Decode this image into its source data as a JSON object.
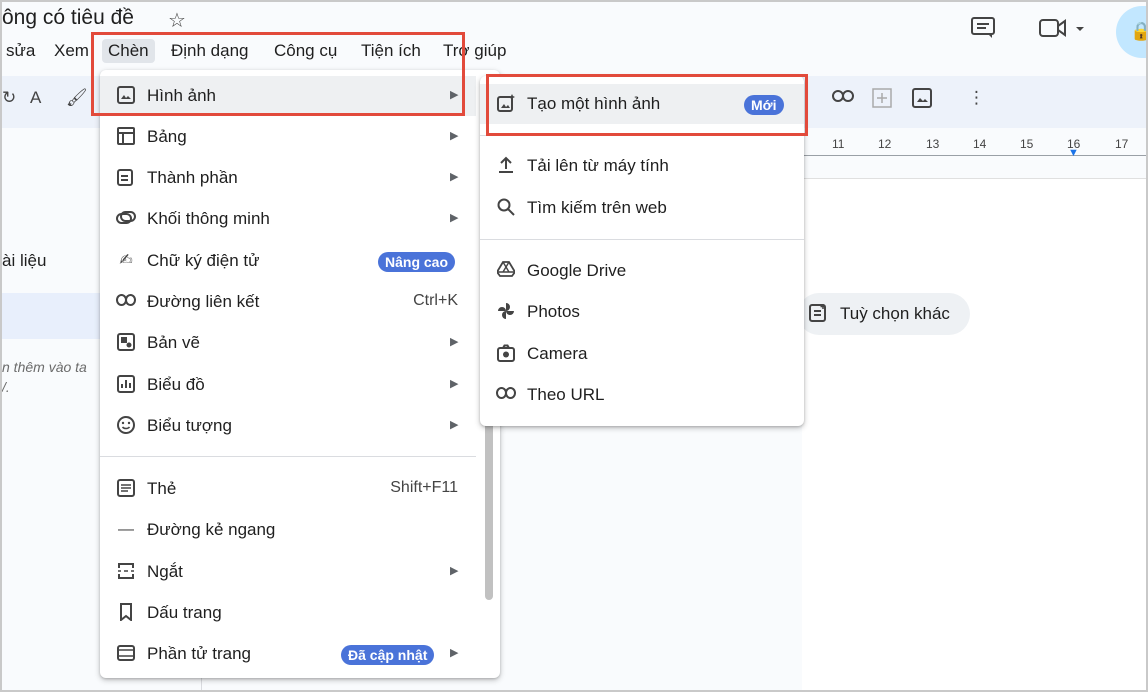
{
  "document": {
    "title": "ông có tiêu đề"
  },
  "menubar": {
    "items": [
      "sửa",
      "Xem",
      "Chèn",
      "Định dạng",
      "Công cụ",
      "Tiện ích",
      "Trợ giúp"
    ]
  },
  "sidebar": {
    "label": "ài liệu",
    "hint_line1": "n thêm vào ta",
    "hint_line2": "/."
  },
  "ruler": {
    "ticks": [
      "11",
      "12",
      "13",
      "14",
      "15",
      "16",
      "17"
    ]
  },
  "more_options": {
    "label": "Tuỳ chọn khác"
  },
  "insert_menu": {
    "items": [
      {
        "label": "Hình ảnh",
        "icon": "image-icon"
      },
      {
        "label": "Bảng",
        "icon": "table-icon"
      },
      {
        "label": "Thành phần",
        "icon": "building-blocks-icon"
      },
      {
        "label": "Khối thông minh",
        "icon": "smart-chips-icon"
      },
      {
        "label": "Chữ ký điện tử",
        "icon": "esignature-icon",
        "badge": "Nâng cao"
      },
      {
        "label": "Đường liên kết",
        "icon": "link-icon",
        "shortcut": "Ctrl+K"
      },
      {
        "label": "Bản vẽ",
        "icon": "drawing-icon"
      },
      {
        "label": "Biểu đồ",
        "icon": "chart-icon"
      },
      {
        "label": "Biểu tượng",
        "icon": "emoji-icon"
      },
      {
        "label": "Thẻ",
        "icon": "tab-icon",
        "shortcut": "Shift+F11"
      },
      {
        "label": "Đường kẻ ngang",
        "icon": "horizontal-line-icon"
      },
      {
        "label": "Ngắt",
        "icon": "break-icon"
      },
      {
        "label": "Dấu trang",
        "icon": "bookmark-icon"
      },
      {
        "label": "Phần tử trang",
        "icon": "page-elements-icon",
        "badge": "Đã cập nhật"
      }
    ]
  },
  "image_submenu": {
    "items": [
      {
        "label": "Tạo một hình ảnh",
        "icon": "generate-image-icon",
        "badge": "Mới"
      },
      {
        "label": "Tải lên từ máy tính",
        "icon": "upload-icon"
      },
      {
        "label": "Tìm kiếm trên web",
        "icon": "search-icon"
      },
      {
        "label": "Google Drive",
        "icon": "google-drive-icon"
      },
      {
        "label": "Photos",
        "icon": "photos-icon"
      },
      {
        "label": "Camera",
        "icon": "camera-icon"
      },
      {
        "label": "Theo URL",
        "icon": "url-link-icon"
      }
    ]
  },
  "colors": {
    "highlight": "#e24a3b",
    "badge": "#4a73d9",
    "toolbar_bg": "#edf2fa"
  }
}
